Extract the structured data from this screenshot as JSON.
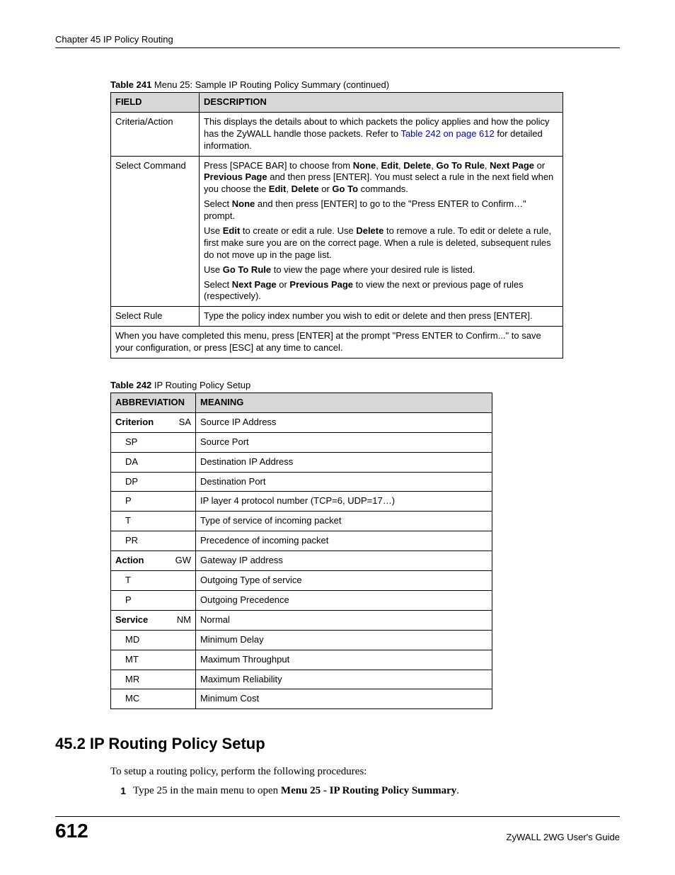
{
  "header": {
    "chapter_line": "Chapter 45 IP Policy Routing"
  },
  "table241": {
    "caption_num": "Table 241",
    "caption_text": "   Menu 25: Sample IP Routing Policy Summary (continued)",
    "head": {
      "field": "FIELD",
      "desc": "DESCRIPTION"
    },
    "rows": {
      "criteria": {
        "field": "Criteria/Action",
        "desc_pre": "This displays the details about to which packets the policy applies and how the policy has the ZyWALL handle those packets. Refer to ",
        "desc_link": "Table 242 on page 612",
        "desc_post": " for detailed information."
      },
      "select_command": {
        "field": "Select Command",
        "p1_a": "Press [SPACE BAR] to choose from ",
        "p1_none": "None",
        "p1_c1": ", ",
        "p1_edit": "Edit",
        "p1_c2": ", ",
        "p1_del": "Delete",
        "p1_c3": ", ",
        "p1_goto": "Go To Rule",
        "p1_c4": ", ",
        "p1_next": "Next Page",
        "p1_b": " or ",
        "p1_prev": "Previous Page",
        "p1_c": " and then press [ENTER]. You must select a rule in the next field when you choose the ",
        "p1_edit2": "Edit",
        "p1_c5": ", ",
        "p1_del2": "Delete",
        "p1_or": " or ",
        "p1_goto2": "Go To",
        "p1_end": " commands.",
        "p2_a": "Select ",
        "p2_none": "None",
        "p2_b": " and then press [ENTER] to go to the \"Press ENTER to Confirm…\" prompt.",
        "p3_a": "Use ",
        "p3_edit": "Edit",
        "p3_b": " to create or edit a rule. Use ",
        "p3_del": "Delete",
        "p3_c": " to remove a rule. To edit or delete a rule, first make sure you are on the correct page. When a rule is deleted, subsequent rules do not move up in the page list.",
        "p4_a": "Use ",
        "p4_goto": "Go To Rule",
        "p4_b": " to view the page where your desired rule is listed.",
        "p5_a": "Select ",
        "p5_next": "Next Page",
        "p5_or": " or ",
        "p5_prev": "Previous Page",
        "p5_b": " to view the next or previous page of rules (respectively)."
      },
      "select_rule": {
        "field": "Select Rule",
        "desc": "Type the policy index number you wish to edit or delete and then press [ENTER]."
      },
      "footer": "When you have completed this menu, press [ENTER] at the prompt \"Press ENTER to Confirm...\" to save your configuration, or press [ESC] at any time to cancel."
    }
  },
  "table242": {
    "caption_num": "Table 242",
    "caption_text": "   IP Routing Policy Setup",
    "head": {
      "abbr": "ABBREVIATION",
      "meaning": "MEANING"
    },
    "rows": [
      {
        "group": "Criterion",
        "code": "SA",
        "meaning": "Source IP Address"
      },
      {
        "group": "",
        "code": "SP",
        "meaning": "Source Port"
      },
      {
        "group": "",
        "code": "DA",
        "meaning": "Destination IP Address"
      },
      {
        "group": "",
        "code": "DP",
        "meaning": "Destination Port"
      },
      {
        "group": "",
        "code": "P",
        "meaning": "IP layer 4 protocol number (TCP=6, UDP=17…)"
      },
      {
        "group": "",
        "code": "T",
        "meaning": "Type of service of incoming packet"
      },
      {
        "group": "",
        "code": "PR",
        "meaning": "Precedence of incoming packet"
      },
      {
        "group": "Action",
        "code": "GW",
        "meaning": "Gateway IP address"
      },
      {
        "group": "",
        "code": "T",
        "meaning": "Outgoing Type of service"
      },
      {
        "group": "",
        "code": "P",
        "meaning": "Outgoing Precedence"
      },
      {
        "group": "Service",
        "code": "NM",
        "meaning": "Normal"
      },
      {
        "group": "",
        "code": "MD",
        "meaning": "Minimum Delay"
      },
      {
        "group": "",
        "code": "MT",
        "meaning": "Maximum Throughput"
      },
      {
        "group": "",
        "code": "MR",
        "meaning": "Maximum Reliability"
      },
      {
        "group": "",
        "code": "MC",
        "meaning": "Minimum Cost"
      }
    ]
  },
  "section": {
    "heading": "45.2  IP Routing Policy Setup",
    "intro": "To setup a routing policy, perform the following procedures:",
    "item1_num": "1",
    "item1_a": "Type 25 in the main menu to open ",
    "item1_bold": "Menu 25 - IP Routing Policy Summary",
    "item1_b": "."
  },
  "footer": {
    "page": "612",
    "guide": "ZyWALL 2WG User's Guide"
  }
}
